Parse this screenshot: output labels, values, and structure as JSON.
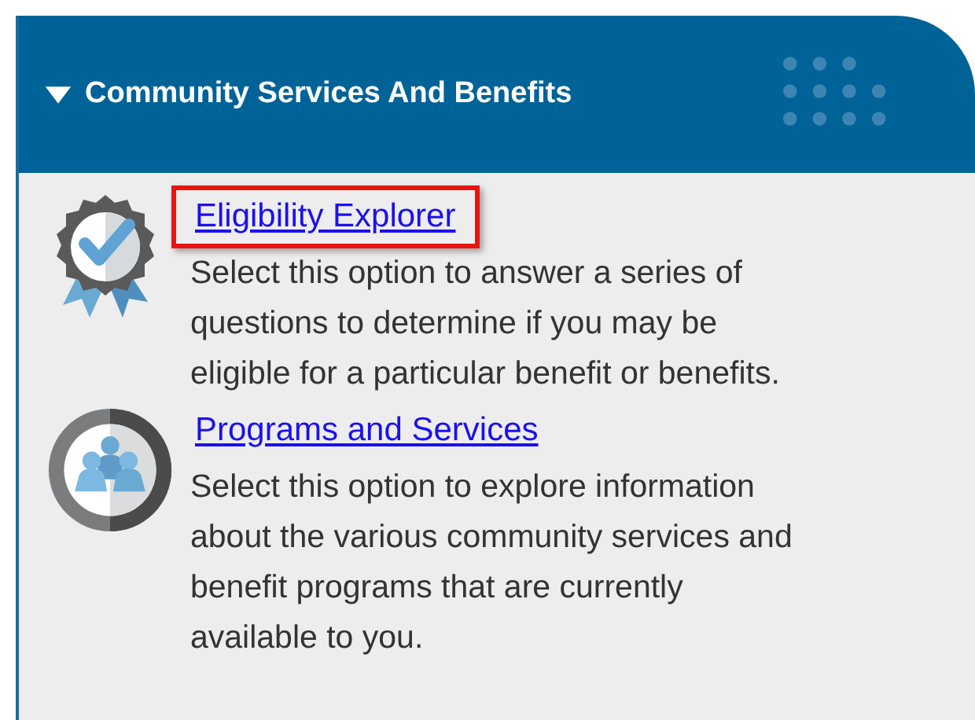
{
  "panel": {
    "title": "Community Services And Benefits",
    "expanded": true
  },
  "items": [
    {
      "kind": "badge",
      "link": "Eligibility Explorer",
      "highlighted": true,
      "description": "Select this option to answer a series of questions to determine if you may be eligible for a particular benefit or benefits."
    },
    {
      "kind": "people",
      "link": "Programs and Services",
      "highlighted": false,
      "description": "Select this option to explore information about the various community services and benefit programs that are currently available to you."
    }
  ]
}
